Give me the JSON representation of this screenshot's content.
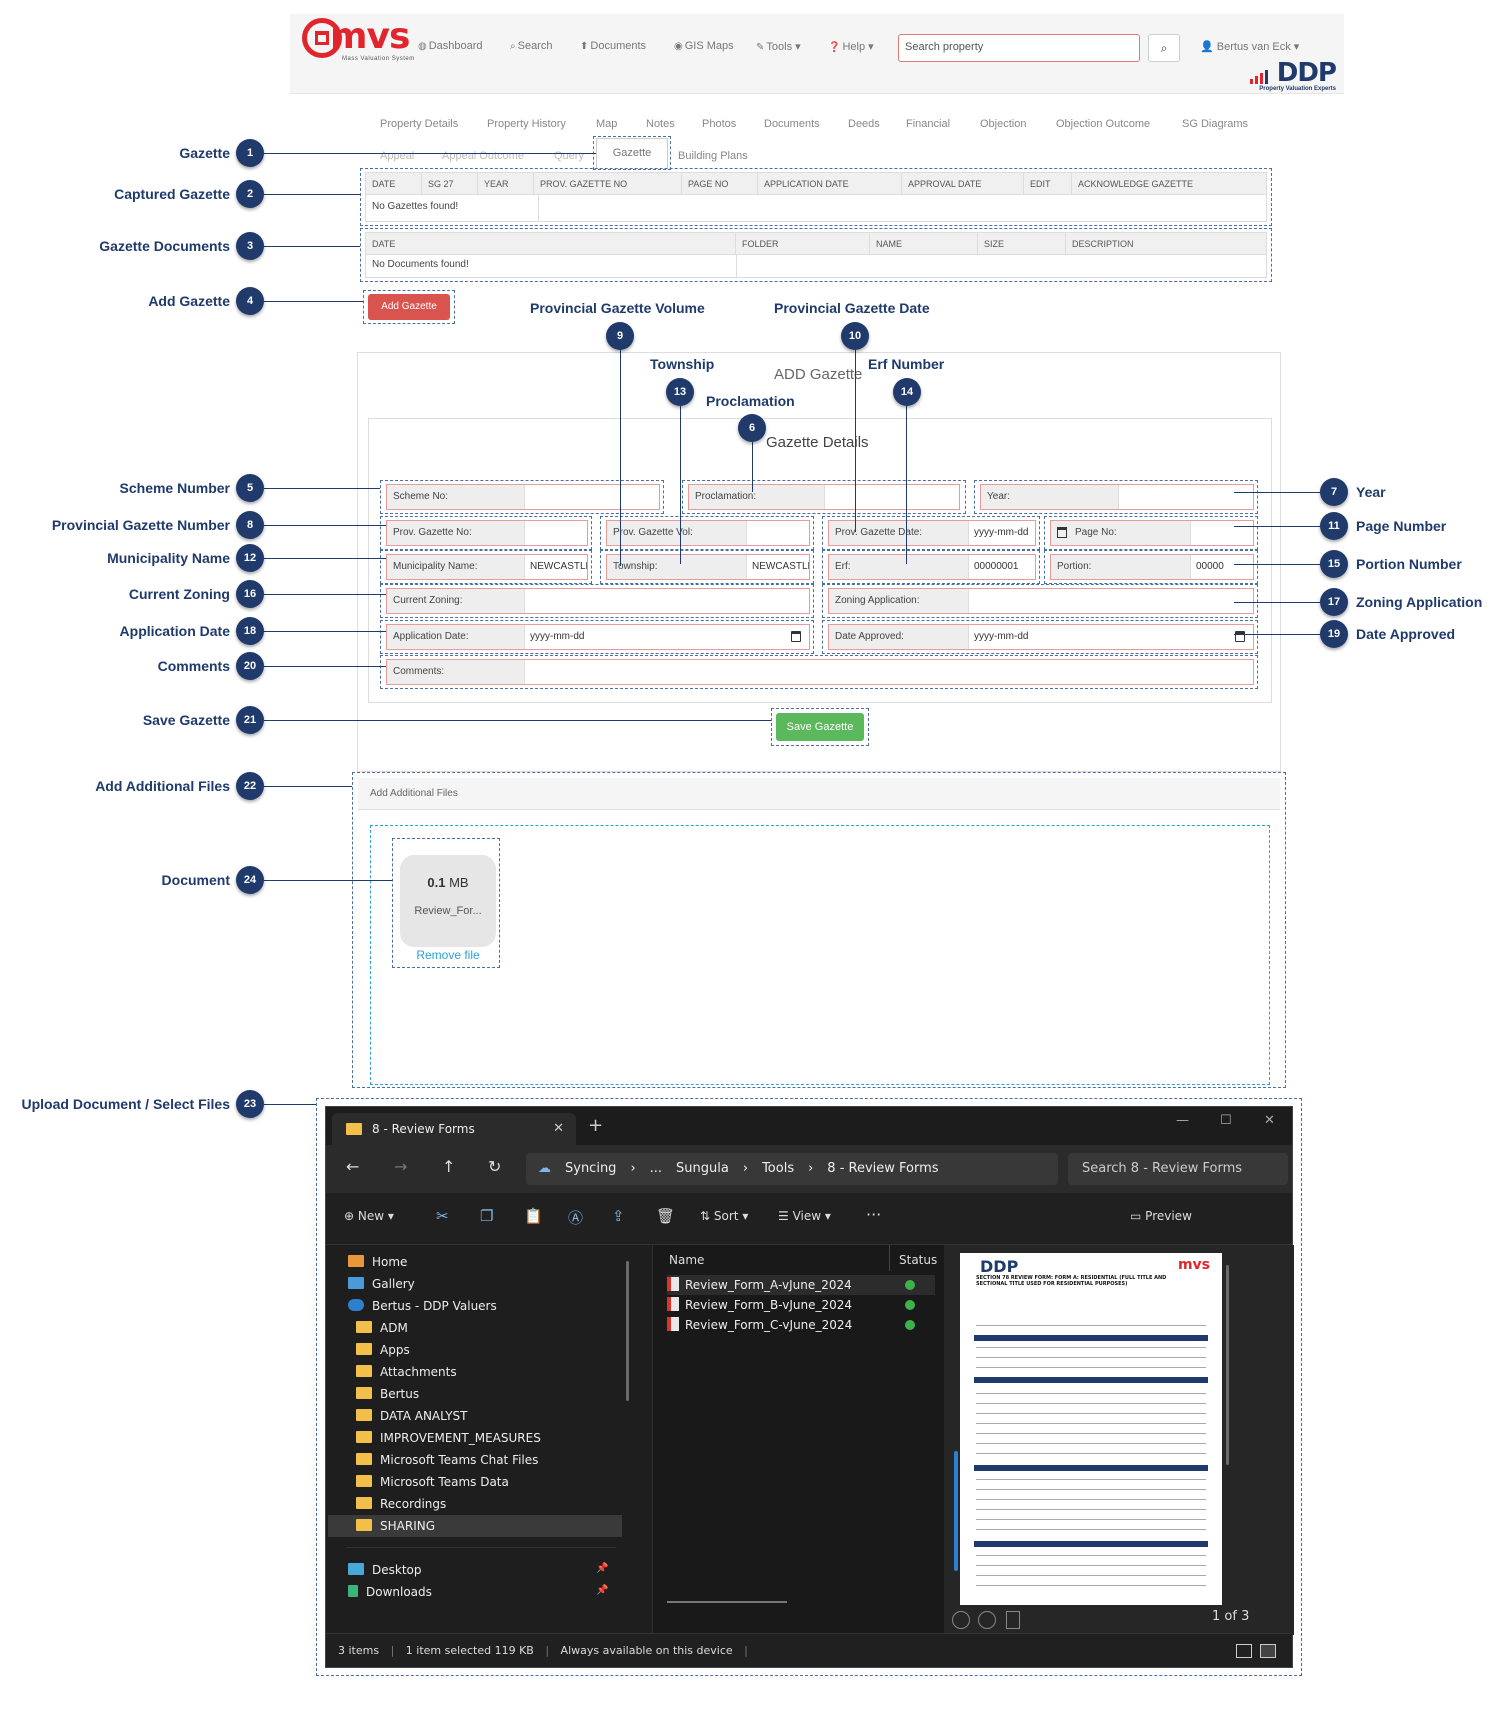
{
  "app": {
    "logo_text": "mvs",
    "logo_tagline": "Mass Valuation System",
    "brand_logo_text": "DDP",
    "brand_logo_tagline": "Property Valuation Experts"
  },
  "navbar": {
    "items": [
      {
        "label": "Dashboard",
        "icon": "dashboard-icon"
      },
      {
        "label": "Search",
        "icon": "search-icon"
      },
      {
        "label": "Documents",
        "icon": "documents-icon"
      },
      {
        "label": "GIS Maps",
        "icon": "globe-icon"
      },
      {
        "label": "Tools",
        "icon": "wrench-icon"
      },
      {
        "label": "Help",
        "icon": "help-icon"
      }
    ],
    "search_placeholder": "Search property",
    "user": "Bertus van Eck"
  },
  "tabs": {
    "row1": [
      "Property Details",
      "Property History",
      "Map",
      "Notes",
      "Photos",
      "Documents",
      "Deeds",
      "Financial",
      "Objection",
      "Objection Outcome",
      "SG Diagrams"
    ],
    "row2_faded": [
      "Appeal",
      "Appeal Outcome",
      "Query"
    ],
    "active": "Gazette",
    "row2_after": "Building Plans"
  },
  "captured_gazette": {
    "columns": [
      "DATE",
      "SG 27",
      "YEAR",
      "PROV. GAZETTE NO",
      "PAGE NO",
      "APPLICATION DATE",
      "APPROVAL DATE",
      "EDIT",
      "ACKNOWLEDGE GAZETTE"
    ],
    "empty_text": "No Gazettes found!"
  },
  "gazette_documents": {
    "columns": [
      "DATE",
      "FOLDER",
      "NAME",
      "SIZE",
      "DESCRIPTION"
    ],
    "empty_text": "No Documents found!"
  },
  "add_gazette_button": "Add Gazette",
  "form": {
    "title": "ADD Gazette",
    "section_title": "Gazette Details",
    "scheme_no": "Scheme No:",
    "proclamation": "Proclamation:",
    "year": "Year:",
    "prov_gazette_no": "Prov. Gazette No:",
    "prov_gazette_vol": "Prov. Gazette Vol:",
    "prov_gazette_date": "Prov. Gazette Date:",
    "prov_gazette_date_value": "yyyy-mm-dd",
    "page_no": "Page No:",
    "municipality_name": "Municipality Name:",
    "municipality_value": "NEWCASTLE",
    "township": "Township:",
    "township_value": "NEWCASTLE",
    "erf": "Erf:",
    "erf_value": "00000001",
    "portion": "Portion:",
    "portion_value": "00000",
    "current_zoning": "Current Zoning:",
    "zoning_application": "Zoning Application:",
    "application_date": "Application Date:",
    "application_date_value": "yyyy-mm-dd",
    "date_approved": "Date Approved:",
    "date_approved_value": "yyyy-mm-dd",
    "comments": "Comments:",
    "save_button": "Save Gazette"
  },
  "additional_files": {
    "header": "Add Additional Files",
    "file_size_num": "0.1",
    "file_size_unit": "MB",
    "file_name": "Review_For...",
    "remove_link": "Remove file"
  },
  "callouts": [
    {
      "n": "1",
      "label": "Gazette"
    },
    {
      "n": "2",
      "label": "Captured Gazette"
    },
    {
      "n": "3",
      "label": "Gazette Documents"
    },
    {
      "n": "4",
      "label": "Add Gazette"
    },
    {
      "n": "5",
      "label": "Scheme Number"
    },
    {
      "n": "6",
      "label": "Proclamation"
    },
    {
      "n": "7",
      "label": "Year"
    },
    {
      "n": "8",
      "label": "Provincial Gazette Number"
    },
    {
      "n": "9",
      "label": "Provincial Gazette Volume"
    },
    {
      "n": "10",
      "label": "Provincial Gazette Date"
    },
    {
      "n": "11",
      "label": "Page Number"
    },
    {
      "n": "12",
      "label": "Municipality Name"
    },
    {
      "n": "13",
      "label": "Township"
    },
    {
      "n": "14",
      "label": "Erf Number"
    },
    {
      "n": "15",
      "label": "Portion Number"
    },
    {
      "n": "16",
      "label": "Current Zoning"
    },
    {
      "n": "17",
      "label": "Zoning Application"
    },
    {
      "n": "18",
      "label": "Application Date"
    },
    {
      "n": "19",
      "label": "Date Approved"
    },
    {
      "n": "20",
      "label": "Comments"
    },
    {
      "n": "21",
      "label": "Save Gazette"
    },
    {
      "n": "22",
      "label": "Add Additional Files"
    },
    {
      "n": "23",
      "label": "Upload Document / Select Files"
    },
    {
      "n": "24",
      "label": "Document"
    }
  ],
  "file_explorer": {
    "tab_title": "8 - Review Forms",
    "path": [
      "Syncing",
      "...",
      "Sungula",
      "Tools",
      "8 - Review Forms"
    ],
    "search_placeholder": "Search 8 - Review Forms",
    "toolbar": {
      "new": "New",
      "sort": "Sort",
      "view": "View",
      "preview": "Preview"
    },
    "nav": [
      "Home",
      "Gallery",
      "Bertus - DDP Valuers",
      "ADM",
      "Apps",
      "Attachments",
      "Bertus",
      "DATA ANALYST",
      "IMPROVEMENT_MEASURES",
      "Microsoft Teams Chat Files",
      "Microsoft Teams Data",
      "Recordings",
      "SHARING",
      "Desktop",
      "Downloads"
    ],
    "columns": {
      "name": "Name",
      "status": "Status"
    },
    "files": [
      "Review_Form_A-vJune_2024",
      "Review_Form_B-vJune_2024",
      "Review_Form_C-vJune_2024"
    ],
    "pager": "1 of 3",
    "status_bar": {
      "items": "3 items",
      "selected": "1 item selected  119 KB",
      "availability": "Always available on this device"
    },
    "preview_doc": {
      "logo": "DDP",
      "logo_right": "mvs",
      "title": "SECTION 78 REVIEW FORM: FORM A: RESIDENTIAL (FULL TITLE AND SECTIONAL TITLE USED FOR RESIDENTIAL PURPOSES)"
    }
  },
  "colors": {
    "callout": "#1f3a6b",
    "add_button": "#d9534f",
    "save_button": "#5cb85c",
    "dashed": "#4a6fa5"
  }
}
